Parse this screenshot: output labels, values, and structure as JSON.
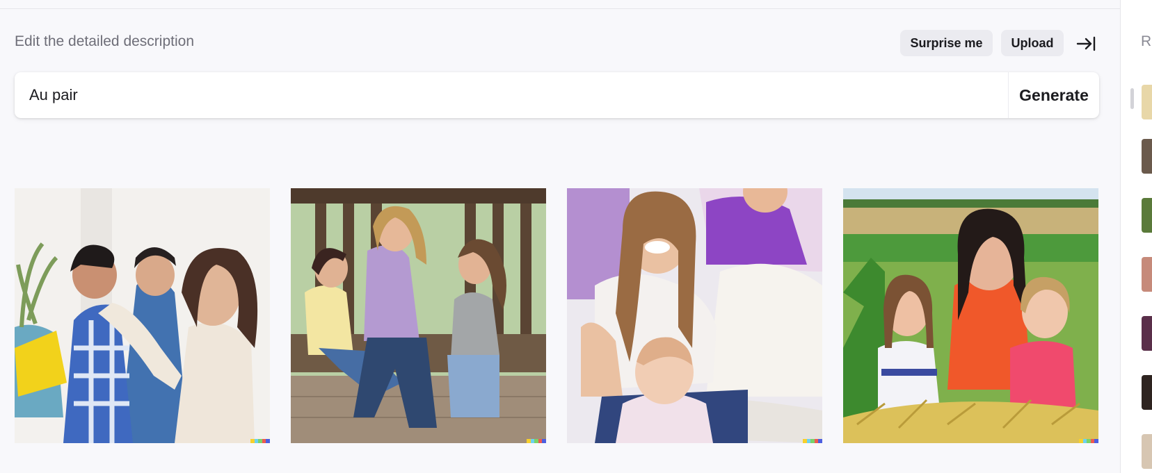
{
  "header": {
    "edit_label": "Edit the detailed description",
    "surprise_label": "Surprise me",
    "upload_label": "Upload",
    "collapse_icon": "arrow-right-to-bar-icon"
  },
  "prompt": {
    "value": "Au pair",
    "generate_label": "Generate"
  },
  "images": [
    {
      "id": 1,
      "alt": "Au pair image 1"
    },
    {
      "id": 2,
      "alt": "Au pair image 2"
    },
    {
      "id": 3,
      "alt": "Au pair image 3"
    },
    {
      "id": 4,
      "alt": "Au pair image 4"
    }
  ],
  "sidebar": {
    "heading": "R",
    "thumbnail_count": 7
  },
  "colors": {
    "background": "#f8f8fb",
    "pill": "#ebebf0",
    "text": "#1b1b1f",
    "muted": "#6e6e78"
  }
}
